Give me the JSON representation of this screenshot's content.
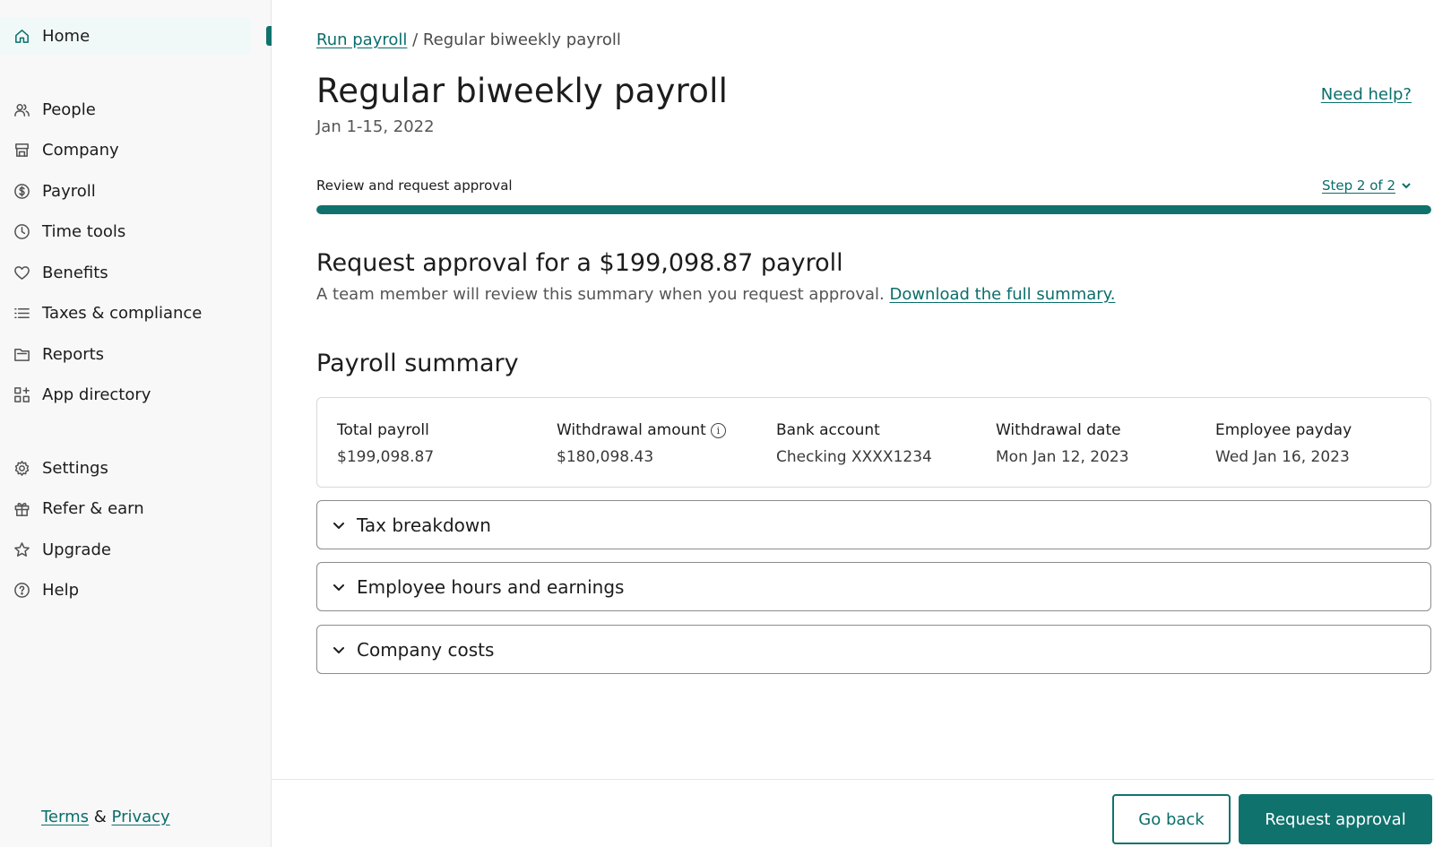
{
  "sidebar": {
    "items": [
      {
        "label": "Home",
        "icon": "home-icon",
        "active": true
      },
      {
        "label": "People",
        "icon": "people-icon"
      },
      {
        "label": "Company",
        "icon": "store-icon"
      },
      {
        "label": "Payroll",
        "icon": "dollar-circle-icon"
      },
      {
        "label": "Time tools",
        "icon": "clock-icon"
      },
      {
        "label": "Benefits",
        "icon": "heart-icon"
      },
      {
        "label": "Taxes & compliance",
        "icon": "list-icon"
      },
      {
        "label": "Reports",
        "icon": "folder-icon"
      },
      {
        "label": "App directory",
        "icon": "apps-grid-icon"
      },
      {
        "label": "Settings",
        "icon": "gear-icon"
      },
      {
        "label": "Refer & earn",
        "icon": "gift-icon"
      },
      {
        "label": "Upgrade",
        "icon": "star-icon"
      },
      {
        "label": "Help",
        "icon": "question-circle-icon"
      }
    ],
    "footer": {
      "terms": "Terms",
      "separator": "&",
      "privacy": "Privacy"
    }
  },
  "breadcrumb": {
    "parent": "Run payroll",
    "separator": "/",
    "current": "Regular biweekly payroll"
  },
  "header": {
    "title": "Regular biweekly payroll",
    "date_range": "Jan 1-15, 2022",
    "help_link": "Need help?"
  },
  "progress": {
    "step_label": "Review and request approval",
    "step_count": "Step 2 of 2",
    "fraction": 1.0
  },
  "approval": {
    "title": "Request approval for a $199,098.87 payroll",
    "description": "A team member will review this summary when you request approval.",
    "download_link": "Download the full summary."
  },
  "summary": {
    "title": "Payroll summary",
    "stats": [
      {
        "label": "Total payroll",
        "value": "$199,098.87"
      },
      {
        "label": "Withdrawal amount",
        "value": "$180,098.43",
        "info": true
      },
      {
        "label": "Bank account",
        "value": "Checking XXXX1234"
      },
      {
        "label": "Withdrawal date",
        "value": "Mon Jan 12, 2023"
      },
      {
        "label": "Employee payday",
        "value": "Wed Jan 16, 2023"
      }
    ]
  },
  "accordions": [
    {
      "label": "Tax breakdown"
    },
    {
      "label": "Employee hours and earnings"
    },
    {
      "label": "Company costs"
    }
  ],
  "actions": {
    "back": "Go back",
    "submit": "Request approval"
  },
  "colors": {
    "accent": "#10726d",
    "link": "#0a6e6b",
    "active_bg": "#f1f9f8"
  }
}
